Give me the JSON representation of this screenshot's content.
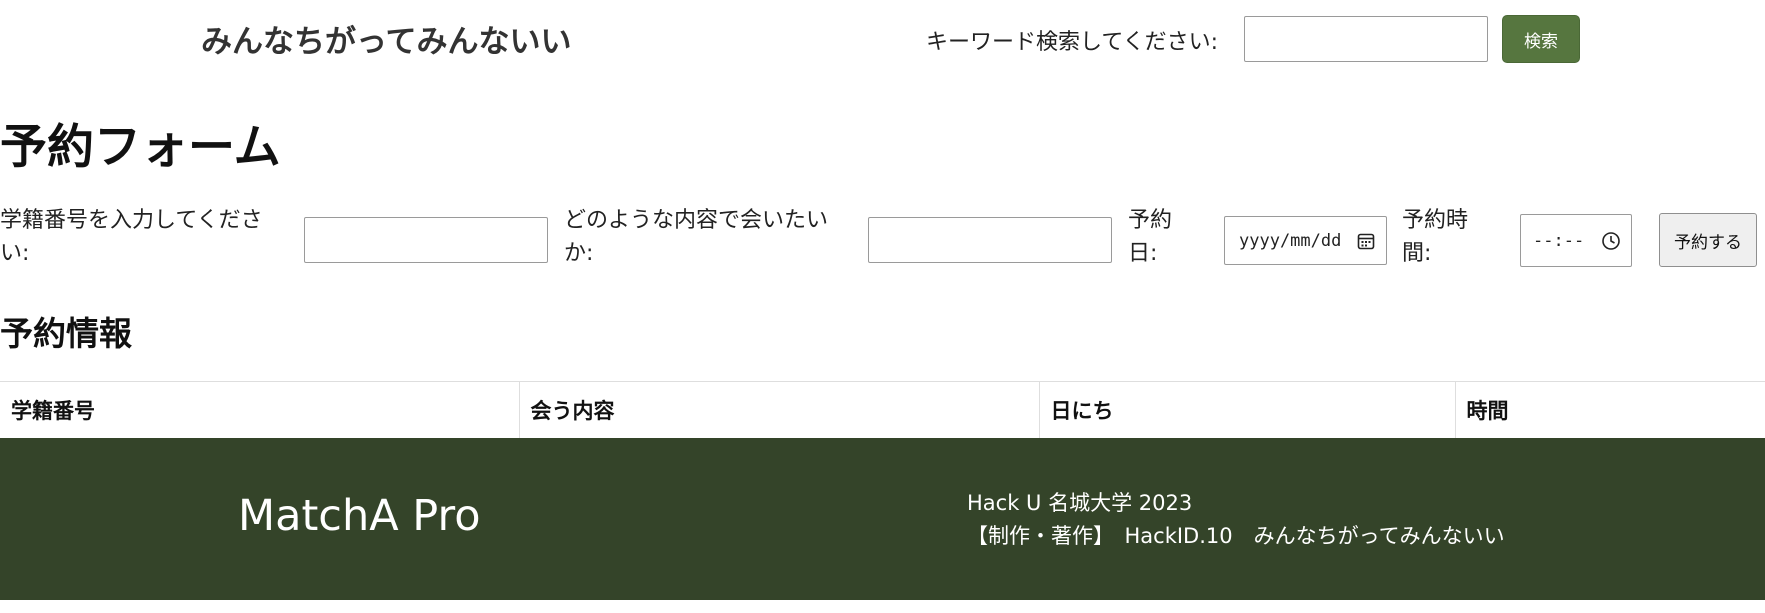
{
  "header": {
    "site_title": "みんなちがってみんないい",
    "search_label": "キーワード検索してください:",
    "search_input_value": "",
    "search_button": "検索"
  },
  "reservation_form": {
    "heading": "予約フォーム",
    "student_id_label": "学籍番号を入力してください:",
    "student_id_value": "",
    "content_label": "どのような内容で会いたいか:",
    "content_value": "",
    "date_label": "予約日:",
    "date_placeholder": "yyyy/mm/dd",
    "time_label": "予約時間:",
    "time_placeholder": "--:--",
    "submit_button": "予約する"
  },
  "reservation_info": {
    "heading": "予約情報",
    "columns": [
      "学籍番号",
      "会う内容",
      "日にち",
      "時間"
    ],
    "rows": []
  },
  "footer": {
    "logo": "MatchA Pro",
    "line1": "Hack U 名城大学 2023",
    "line2": "【制作・著作】　HackID.10　みんなちがってみんないい"
  },
  "colors": {
    "search_button_bg": "#56763f",
    "footer_bg": "#344429"
  },
  "icons": [
    "calendar-icon",
    "clock-icon"
  ]
}
